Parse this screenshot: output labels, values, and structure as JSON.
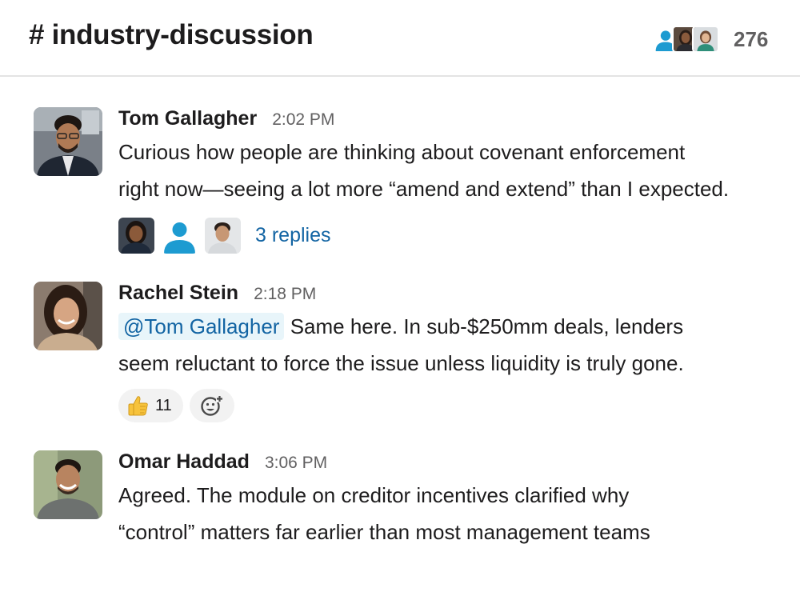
{
  "channel": {
    "name": "# industry-discussion",
    "member_count": "276"
  },
  "messages": [
    {
      "author": "Tom Gallagher",
      "time": "2:02 PM",
      "text_line1": "Curious how people are thinking about covenant enforcement",
      "text_line2": "right now—seeing a lot more “amend and extend” than I expected.",
      "replies_label": "3 replies"
    },
    {
      "author": "Rachel Stein",
      "time": "2:18 PM",
      "mention": "@Tom Gallagher",
      "text_line1": " Same here. In sub-$250mm deals, lenders",
      "text_line2": "seem reluctant to force the issue unless liquidity is truly gone.",
      "reaction": {
        "emoji": "thumbs-up",
        "count": "11"
      }
    },
    {
      "author": "Omar Haddad",
      "time": "3:06 PM",
      "text_line1": "Agreed. The module on creditor incentives clarified why",
      "text_line2": "“control” matters far earlier than most management teams"
    }
  ],
  "icons": {
    "reaction_emoji": "thumbs-up-icon",
    "add_reaction": "add-emoji-icon",
    "default_avatar": "person-silhouette-icon"
  },
  "colors": {
    "link": "#1264a3",
    "mention_bg": "#e8f5fa",
    "default_avatar": "#1d9bd1"
  }
}
